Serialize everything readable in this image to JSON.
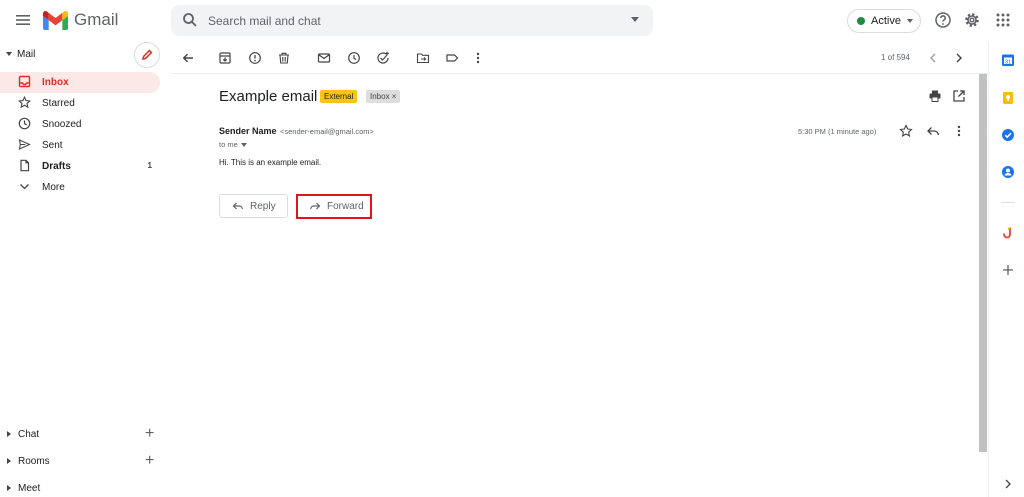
{
  "app": {
    "name": "Gmail"
  },
  "search": {
    "placeholder": "Search mail and chat"
  },
  "status": {
    "label": "Active",
    "color": "#1e8e3e"
  },
  "sidebar": {
    "mail_section": "Mail",
    "items": [
      {
        "label": "Inbox",
        "icon": "inbox-icon",
        "selected": true,
        "count": ""
      },
      {
        "label": "Starred",
        "icon": "star-icon",
        "count": ""
      },
      {
        "label": "Snoozed",
        "icon": "clock-icon",
        "count": ""
      },
      {
        "label": "Sent",
        "icon": "send-icon",
        "count": ""
      },
      {
        "label": "Drafts",
        "icon": "draft-icon",
        "count": "1"
      },
      {
        "label": "More",
        "icon": "chevron-down-icon",
        "count": ""
      }
    ],
    "bottom": [
      {
        "label": "Chat"
      },
      {
        "label": "Rooms"
      },
      {
        "label": "Meet"
      }
    ]
  },
  "toolbar": {
    "icons": [
      "back-icon",
      "archive-icon",
      "report-spam-icon",
      "delete-icon",
      "mark-unread-icon",
      "snooze-icon",
      "add-task-icon",
      "move-to-icon",
      "label-icon",
      "more-vert-icon"
    ],
    "pager": "1 of 594"
  },
  "email": {
    "subject": "Example email",
    "labels": {
      "external": "External",
      "inbox": "Inbox ×"
    },
    "sender_name": "Sender Name",
    "sender_email": "<sender-email@gmail.com>",
    "to": "to me",
    "timestamp": "5:30 PM (1 minute ago)",
    "body": "Hi. This is an example email."
  },
  "actions": {
    "reply": "Reply",
    "forward": "Forward"
  },
  "colors": {
    "accent_red": "#d93025",
    "highlight_box": "#e0141e",
    "external_label": "#f9c416"
  }
}
